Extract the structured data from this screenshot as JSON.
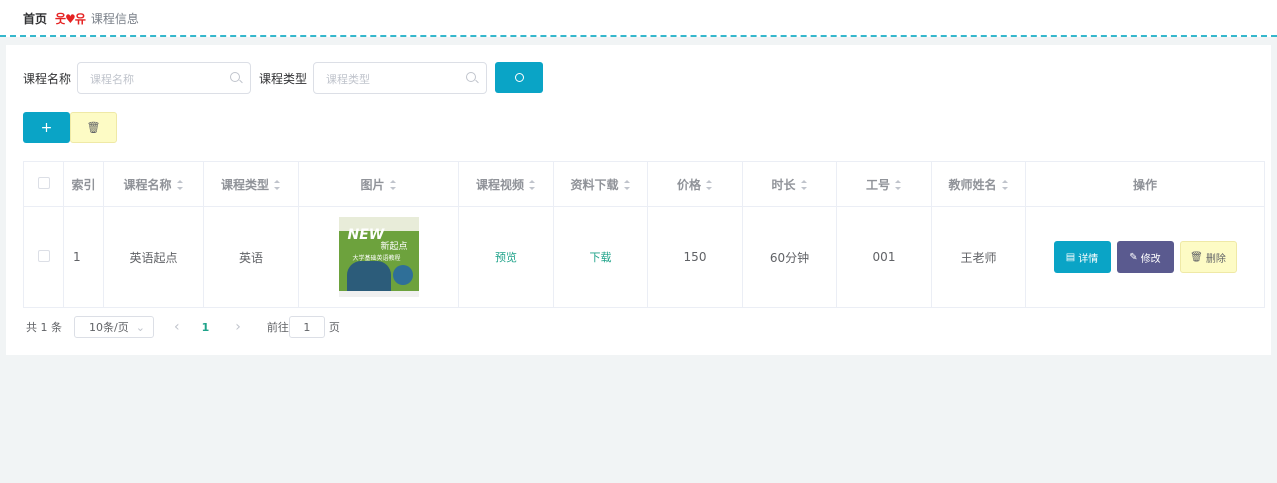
{
  "breadcrumb": {
    "home": "首页",
    "separator": "웃♥유",
    "current": "课程信息"
  },
  "search": {
    "name_label": "课程名称",
    "name_placeholder": "课程名称",
    "type_label": "课程类型",
    "type_placeholder": "课程类型"
  },
  "toolbar": {
    "add_label": "+",
    "delete_icon": "trash-icon"
  },
  "table": {
    "columns": [
      "索引",
      "课程名称",
      "课程类型",
      "图片",
      "课程视频",
      "资料下载",
      "价格",
      "时长",
      "工号",
      "教师姓名",
      "操作"
    ],
    "rows": [
      {
        "index": "1",
        "course_name": "英语起点",
        "course_type": "英语",
        "image": {
          "brand": "NEW",
          "title": "新起点",
          "subtitle": "大学基础英语教程"
        },
        "video": "预览",
        "download": "下载",
        "price": "150",
        "duration": "60分钟",
        "staff_no": "001",
        "teacher": "王老师",
        "actions": {
          "detail": "详情",
          "edit": "修改",
          "delete": "删除"
        }
      }
    ]
  },
  "pagination": {
    "total": "共 1 条",
    "page_size": "10条/页",
    "prev": "‹",
    "current_page": "1",
    "next": "›",
    "goto_label": "前往",
    "goto_value": "1",
    "page_suffix": "页"
  },
  "colors": {
    "accent": "#0aa4c6",
    "warning": "#fdfbc5",
    "edit": "#5a5a8f",
    "link": "#1fa38a"
  }
}
